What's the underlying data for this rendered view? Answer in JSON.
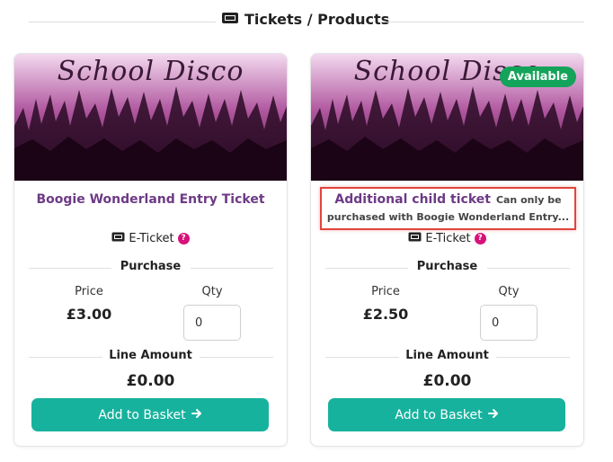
{
  "section": {
    "title": "Tickets / Products",
    "icon": "ticket-icon"
  },
  "cards": [
    {
      "banner_text": "School Disco",
      "badge": "",
      "name": "Boogie Wonderland Entry Ticket",
      "note": "",
      "ticket_type": "E-Ticket",
      "help": "?",
      "purchase_heading": "Purchase",
      "price_label": "Price",
      "price": "£3.00",
      "qty_label": "Qty",
      "qty_value": "0",
      "line_amount_heading": "Line Amount",
      "line_amount": "£0.00",
      "button_label": "Add to Basket",
      "button_icon": "arrow-right-icon"
    },
    {
      "banner_text": "School Disco",
      "badge": "Available",
      "name": "Additional child ticket",
      "note_line1": "Can only be",
      "note_line2": "purchased with Boogie Wonderland Entry...",
      "ticket_type": "E-Ticket",
      "help": "?",
      "purchase_heading": "Purchase",
      "price_label": "Price",
      "price": "£2.50",
      "qty_label": "Qty",
      "qty_value": "0",
      "line_amount_heading": "Line Amount",
      "line_amount": "£0.00",
      "button_label": "Add to Basket",
      "button_icon": "arrow-right-icon"
    }
  ],
  "colors": {
    "accent": "#17b29d",
    "product_name": "#6d3a86",
    "badge": "#14a35a",
    "help": "#d6117a",
    "highlight_border": "#e0443f"
  }
}
